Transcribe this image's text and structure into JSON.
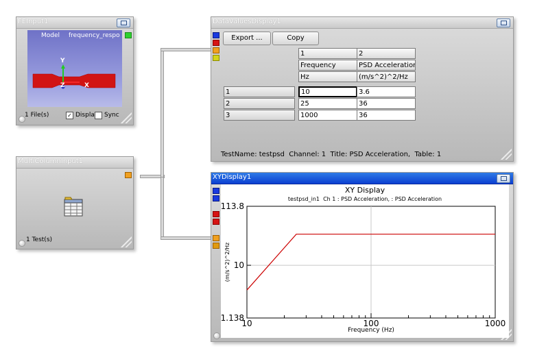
{
  "wires_color": "#d8d8d8",
  "fe_input": {
    "title": "FEInput1",
    "model_label": "Model",
    "model_name": "frequency_respo",
    "axis_y": "Y",
    "axis_z": "Z",
    "axis_x": "X",
    "files": "1 File(s)",
    "display_label": "Displa",
    "sync_label": "Sync",
    "display_checked": true,
    "sync_checked": false
  },
  "multicolumn_input": {
    "title": "MultiColumnInput1",
    "tests": "1 Test(s)"
  },
  "data_values_display": {
    "title": "DataValuesDisplay1",
    "export_label": "Export ...",
    "copy_label": "Copy",
    "columns": [
      {
        "index": "1",
        "name": "Frequency",
        "unit": "Hz"
      },
      {
        "index": "2",
        "name": "PSD Acceleration",
        "unit": "(m/s^2)^2/Hz"
      }
    ],
    "rows": [
      {
        "label": "1",
        "values": [
          "10",
          "3.6"
        ]
      },
      {
        "label": "2",
        "values": [
          "25",
          "36"
        ]
      },
      {
        "label": "3",
        "values": [
          "1000",
          "36"
        ]
      }
    ],
    "footer": "TestName: testpsd  Channel: 1  Title: PSD Acceleration,  Table: 1"
  },
  "xy_display": {
    "title": "XYDisplay1",
    "plot_title": "XY Display",
    "subtitle": "testpsd_in1  Ch 1 : PSD Acceleration, : PSD Acceleration"
  },
  "chart_data": {
    "type": "line",
    "title": "XY Display",
    "subtitle": "testpsd_in1  Ch 1 : PSD Acceleration, : PSD Acceleration",
    "xlabel": "Frequency (Hz)",
    "ylabel": "(m/s^2)^2/Hz",
    "x_scale": "log",
    "y_scale": "log",
    "xlim": [
      10,
      1000
    ],
    "ylim": [
      1.138,
      113.8
    ],
    "x_ticks": [
      "10",
      "100",
      "1000"
    ],
    "y_ticks": [
      "1.138",
      "10",
      "113.8"
    ],
    "grid": true,
    "series": [
      {
        "x": [
          10,
          25,
          1000
        ],
        "y": [
          3.6,
          36,
          36
        ],
        "color": "#cc0000"
      }
    ]
  }
}
